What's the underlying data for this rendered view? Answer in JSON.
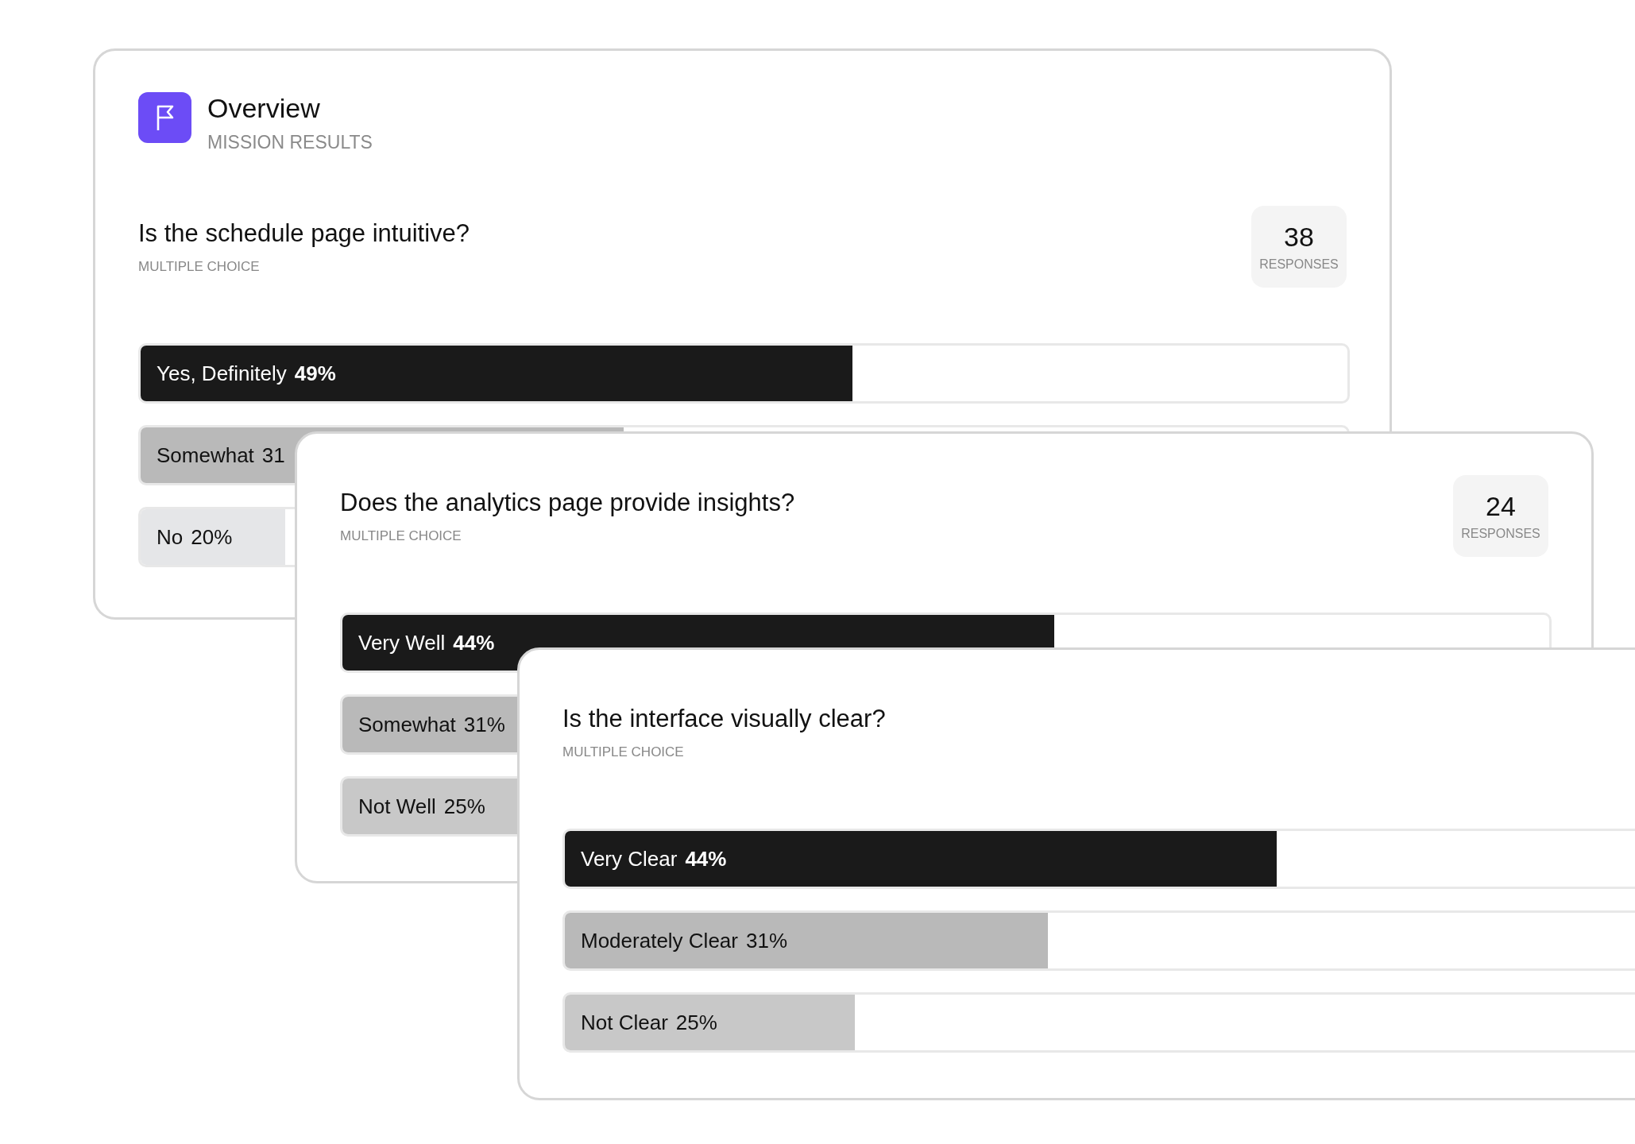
{
  "header": {
    "title": "Overview",
    "subtitle": "MISSION RESULTS"
  },
  "cards": [
    {
      "question": "Is the schedule page intuitive?",
      "type": "MULTIPLE CHOICE",
      "responses": {
        "count": "38",
        "label": "RESPONSES"
      },
      "options": [
        {
          "kind": "leading",
          "label": "Yes, Definitely",
          "percent": "49%",
          "level": 0.59,
          "color": "#1a1a1a"
        },
        {
          "kind": "other",
          "label": "Somewhat",
          "percent": "31",
          "level": 0.4,
          "color": "#b9b9b9"
        },
        {
          "kind": "other",
          "label": "No",
          "percent": "20%",
          "level": 0.12,
          "color": "#e5e6e8"
        }
      ]
    },
    {
      "question": "Does the analytics page provide insights?",
      "type": "MULTIPLE CHOICE",
      "responses": {
        "count": "24",
        "label": "RESPONSES"
      },
      "options": [
        {
          "kind": "leading",
          "label": "Very Well",
          "percent": "44%",
          "level": 0.59,
          "color": "#1a1a1a"
        },
        {
          "kind": "other",
          "label": "Somewhat",
          "percent": "31%",
          "level": 0.4,
          "color": "#b9b9b9"
        },
        {
          "kind": "other",
          "label": "Not Well",
          "percent": "25%",
          "level": 0.24,
          "color": "#c8c8c8"
        }
      ]
    },
    {
      "question": "Is the interface visually clear?",
      "type": "MULTIPLE CHOICE",
      "options": [
        {
          "kind": "leading",
          "label": "Very Clear",
          "percent": "44%",
          "level": 0.59,
          "color": "#1a1a1a"
        },
        {
          "kind": "other",
          "label": "Moderately Clear",
          "percent": "31%",
          "level": 0.4,
          "color": "#b9b9b9"
        },
        {
          "kind": "other",
          "label": "Not Clear",
          "percent": "25%",
          "level": 0.24,
          "color": "#c8c8c8"
        }
      ]
    }
  ]
}
